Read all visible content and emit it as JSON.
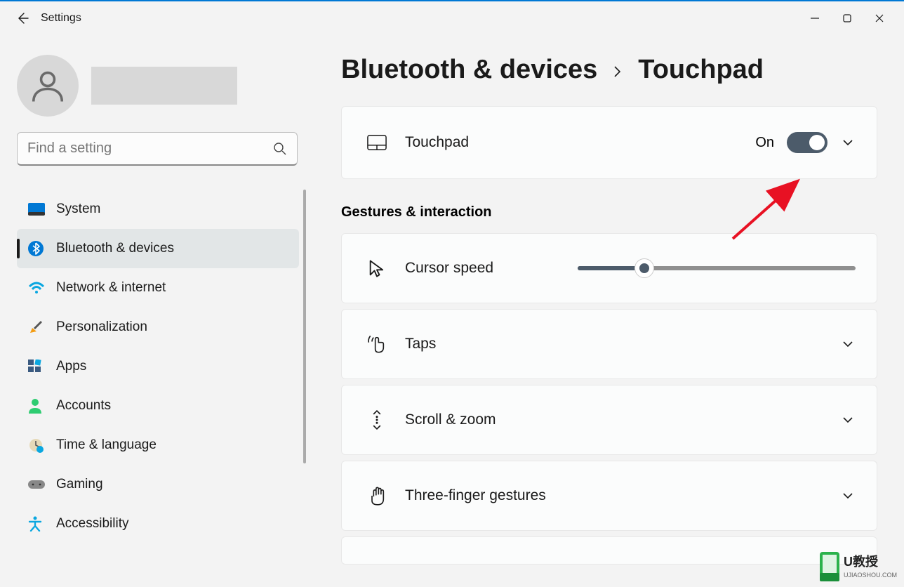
{
  "window": {
    "title": "Settings"
  },
  "search": {
    "placeholder": "Find a setting"
  },
  "sidebar": {
    "items": [
      {
        "label": "System"
      },
      {
        "label": "Bluetooth & devices"
      },
      {
        "label": "Network & internet"
      },
      {
        "label": "Personalization"
      },
      {
        "label": "Apps"
      },
      {
        "label": "Accounts"
      },
      {
        "label": "Time & language"
      },
      {
        "label": "Gaming"
      },
      {
        "label": "Accessibility"
      }
    ],
    "active_index": 1
  },
  "breadcrumb": {
    "parent": "Bluetooth & devices",
    "current": "Touchpad"
  },
  "touchpad": {
    "label": "Touchpad",
    "state": "On",
    "toggle_on": true
  },
  "gestures": {
    "title": "Gestures & interaction",
    "items": [
      {
        "label": "Cursor speed",
        "type": "slider",
        "value_percent": 24
      },
      {
        "label": "Taps",
        "type": "expand"
      },
      {
        "label": "Scroll & zoom",
        "type": "expand"
      },
      {
        "label": "Three-finger gestures",
        "type": "expand"
      }
    ]
  },
  "watermark": {
    "brand": "U教授",
    "url": "UJIAOSHOU.COM"
  }
}
